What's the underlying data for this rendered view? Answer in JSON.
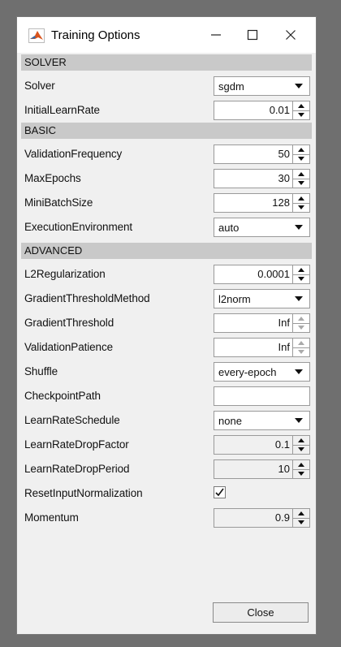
{
  "window": {
    "title": "Training Options",
    "icon": "matlab-icon",
    "minimize_icon": "minimize-icon",
    "maximize_icon": "maximize-icon",
    "close_icon": "close-icon"
  },
  "sections": {
    "solver": "SOLVER",
    "basic": "BASIC",
    "advanced": "ADVANCED"
  },
  "fields": {
    "solver": {
      "label": "Solver",
      "value": "sgdm"
    },
    "initial_learn_rate": {
      "label": "InitialLearnRate",
      "value": "0.01"
    },
    "validation_frequency": {
      "label": "ValidationFrequency",
      "value": "50"
    },
    "max_epochs": {
      "label": "MaxEpochs",
      "value": "30"
    },
    "mini_batch_size": {
      "label": "MiniBatchSize",
      "value": "128"
    },
    "execution_environment": {
      "label": "ExecutionEnvironment",
      "value": "auto"
    },
    "l2_regularization": {
      "label": "L2Regularization",
      "value": "0.0001"
    },
    "gradient_threshold_method": {
      "label": "GradientThresholdMethod",
      "value": "l2norm"
    },
    "gradient_threshold": {
      "label": "GradientThreshold",
      "value": "Inf"
    },
    "validation_patience": {
      "label": "ValidationPatience",
      "value": "Inf"
    },
    "shuffle": {
      "label": "Shuffle",
      "value": "every-epoch"
    },
    "checkpoint_path": {
      "label": "CheckpointPath",
      "value": ""
    },
    "learn_rate_schedule": {
      "label": "LearnRateSchedule",
      "value": "none"
    },
    "learn_rate_drop_factor": {
      "label": "LearnRateDropFactor",
      "value": "0.1"
    },
    "learn_rate_drop_period": {
      "label": "LearnRateDropPeriod",
      "value": "10"
    },
    "reset_input_normalization": {
      "label": "ResetInputNormalization",
      "checked": true
    },
    "momentum": {
      "label": "Momentum",
      "value": "0.9"
    }
  },
  "buttons": {
    "close": "Close"
  }
}
